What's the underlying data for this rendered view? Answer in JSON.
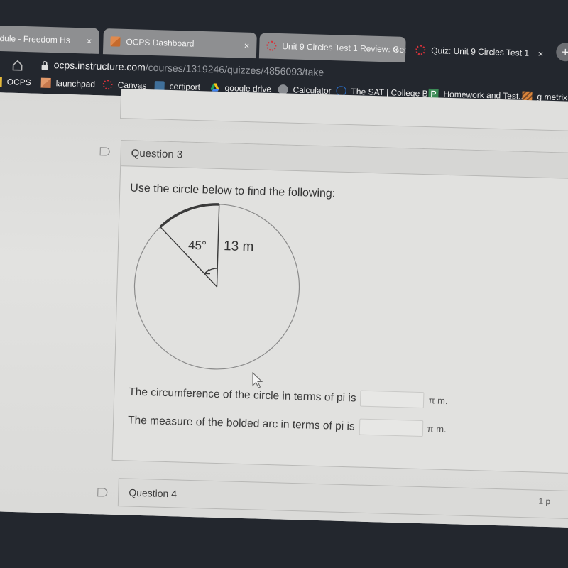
{
  "browser": {
    "tabs": [
      {
        "label": "dule - Freedom Hs",
        "favicon": "none",
        "close": "×"
      },
      {
        "label": "OCPS Dashboard",
        "favicon": "ocps-grid-icon",
        "close": "×"
      },
      {
        "label": "Unit 9 Circles Test 1 Review: Geo",
        "favicon": "canvas-icon",
        "close": "×"
      },
      {
        "label": "Quiz: Unit 9 Circles Test 1",
        "favicon": "canvas-icon",
        "close": "×",
        "active": true
      }
    ],
    "new_tab": "+",
    "url_host": "ocps.instructure.com",
    "url_path": "/courses/1319246/quizzes/4856093/take",
    "bookmarks": [
      {
        "label": "OCPS",
        "icon": "folder-icon"
      },
      {
        "label": "launchpad",
        "icon": "grid-icon"
      },
      {
        "label": "Canvas",
        "icon": "canvas-icon"
      },
      {
        "label": "certiport",
        "icon": "certiport-icon"
      },
      {
        "label": "google drive",
        "icon": "google-drive-icon"
      },
      {
        "label": "Calculator",
        "icon": "globe-icon"
      },
      {
        "label": "The SAT | College B...",
        "icon": "acorn-icon"
      },
      {
        "label": "Homework and Test...",
        "icon": "p-icon"
      },
      {
        "label": "g metrix d",
        "icon": "gmetrix-icon"
      }
    ]
  },
  "quiz": {
    "question3": {
      "title": "Question 3",
      "prompt": "Use the circle below to find the following:",
      "diagram": {
        "angle_label": "45°",
        "radius_label": "13 m",
        "angle_degrees": 45,
        "radius_m": 13
      },
      "answers": [
        {
          "label": "The circumference of the circle in terms of pi is",
          "value": "",
          "unit": "π m."
        },
        {
          "label": "The measure of the bolded arc in terms of pi is",
          "value": "",
          "unit": "π m."
        }
      ]
    },
    "question4": {
      "title": "Question 4",
      "points": "1 p"
    }
  }
}
